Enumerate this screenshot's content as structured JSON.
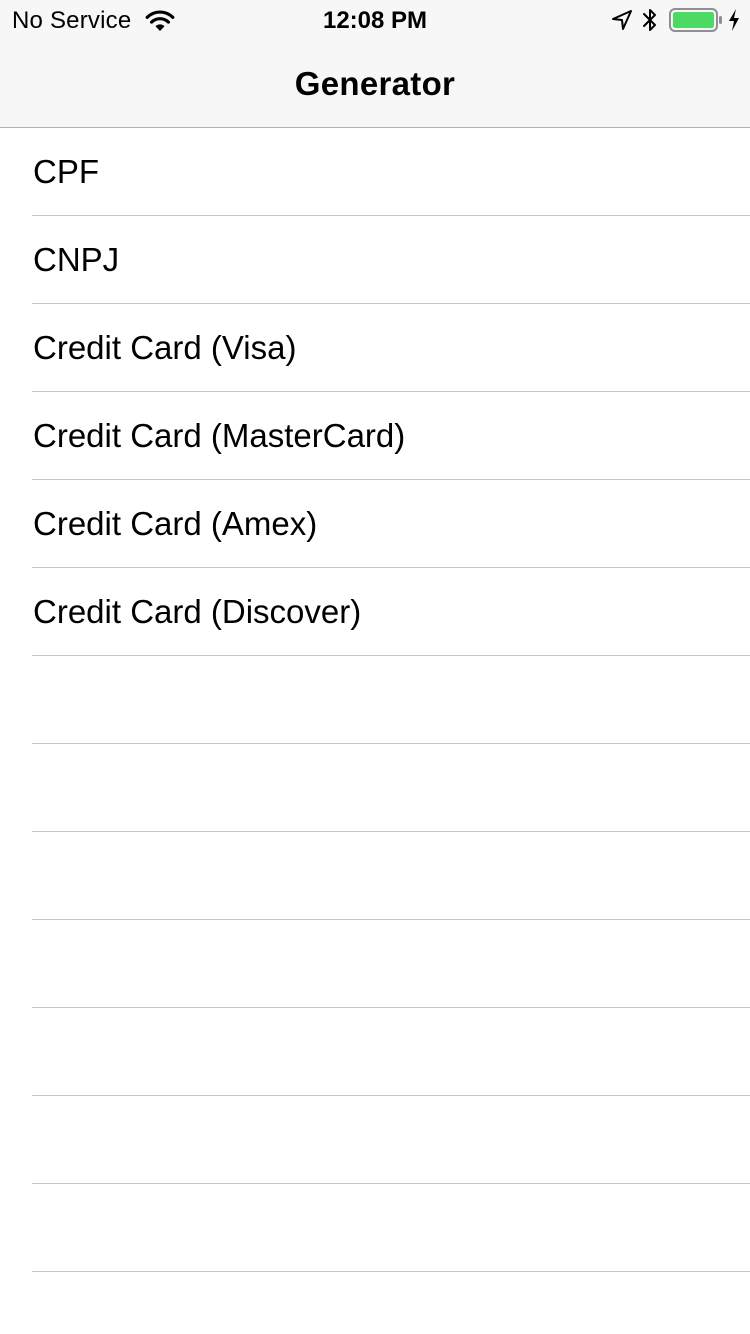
{
  "status_bar": {
    "carrier": "No Service",
    "time": "12:08 PM",
    "icons": [
      "wifi-icon",
      "location-icon",
      "bluetooth-icon",
      "battery-icon",
      "charging-icon"
    ],
    "battery_level": 1.0,
    "battery_color": "#4cd964"
  },
  "nav": {
    "title": "Generator"
  },
  "list": {
    "items": [
      {
        "label": "CPF"
      },
      {
        "label": "CNPJ"
      },
      {
        "label": "Credit Card (Visa)"
      },
      {
        "label": "Credit Card (MasterCard)"
      },
      {
        "label": "Credit Card (Amex)"
      },
      {
        "label": "Credit Card (Discover)"
      }
    ],
    "empty_rows": 7
  },
  "colors": {
    "nav_background": "#f7f7f7",
    "separator": "#c8c7cc",
    "text": "#000000"
  }
}
